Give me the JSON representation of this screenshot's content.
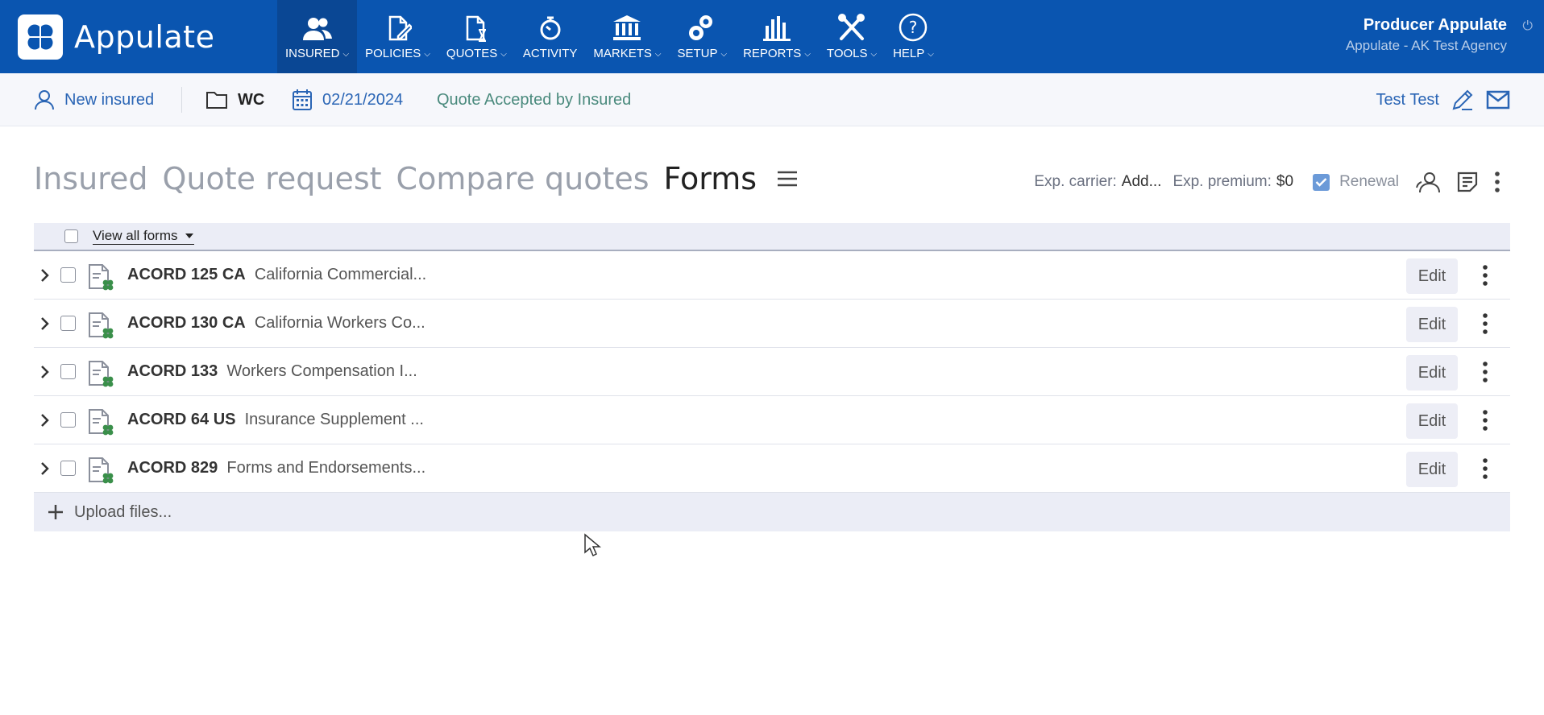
{
  "app": {
    "name": "Appulate"
  },
  "nav": [
    {
      "label": "INSURED",
      "icon": "insured-icon",
      "dropdown": true,
      "active": true
    },
    {
      "label": "POLICIES",
      "icon": "policies-icon",
      "dropdown": true
    },
    {
      "label": "QUOTES",
      "icon": "quotes-icon",
      "dropdown": true
    },
    {
      "label": "ACTIVITY",
      "icon": "activity-icon",
      "dropdown": false
    },
    {
      "label": "MARKETS",
      "icon": "markets-icon",
      "dropdown": true
    },
    {
      "label": "SETUP",
      "icon": "setup-icon",
      "dropdown": true
    },
    {
      "label": "REPORTS",
      "icon": "reports-icon",
      "dropdown": true
    },
    {
      "label": "TOOLS",
      "icon": "tools-icon",
      "dropdown": true
    },
    {
      "label": "HELP",
      "icon": "help-icon",
      "dropdown": true
    }
  ],
  "user": {
    "name": "Producer Appulate",
    "agency": "Appulate - AK Test Agency"
  },
  "subbar": {
    "new_insured": "New insured",
    "line": "WC",
    "date": "02/21/2024",
    "status": "Quote Accepted by Insured",
    "contact": "Test Test"
  },
  "tabs": [
    {
      "label": "Insured",
      "active": false
    },
    {
      "label": "Quote request",
      "active": false
    },
    {
      "label": "Compare quotes",
      "active": false
    },
    {
      "label": "Forms",
      "active": true
    }
  ],
  "toolbar": {
    "exp_carrier_label": "Exp. carrier:",
    "exp_carrier_value": "Add...",
    "exp_premium_label": "Exp. premium:",
    "exp_premium_value": "$0",
    "renewal_label": "Renewal",
    "renewal_checked": true
  },
  "forms": {
    "view_all_label": "View all forms",
    "edit_label": "Edit",
    "rows": [
      {
        "code": "ACORD 125 CA",
        "description": "California Commercial..."
      },
      {
        "code": "ACORD 130 CA",
        "description": "California Workers Co..."
      },
      {
        "code": "ACORD 133",
        "description": "Workers Compensation I..."
      },
      {
        "code": "ACORD 64 US",
        "description": "Insurance Supplement ..."
      },
      {
        "code": "ACORD 829",
        "description": "Forms and Endorsements..."
      }
    ],
    "upload_label": "Upload files..."
  },
  "colors": {
    "primary": "#0a55b0",
    "status": "#4a8a7d",
    "link": "#2a65b5"
  }
}
